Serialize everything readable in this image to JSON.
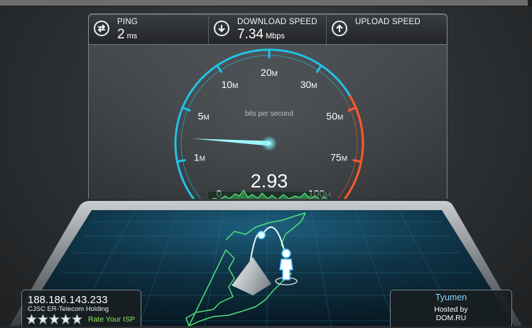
{
  "stats": {
    "ping": {
      "label": "PING",
      "value": "2",
      "unit": "ms",
      "icon": "ping-arrows-icon"
    },
    "download": {
      "label": "DOWNLOAD SPEED",
      "value": "7.34",
      "unit": "Mbps",
      "icon": "download-arrow-icon"
    },
    "upload": {
      "label": "UPLOAD SPEED",
      "value": "",
      "unit": "",
      "icon": "upload-arrow-icon"
    }
  },
  "gauge": {
    "caption": "bits per second",
    "current_value": "2.93",
    "ticks": [
      {
        "num": "0",
        "unit": ""
      },
      {
        "num": "1",
        "unit": "M"
      },
      {
        "num": "5",
        "unit": "M"
      },
      {
        "num": "10",
        "unit": "M"
      },
      {
        "num": "20",
        "unit": "M"
      },
      {
        "num": "30",
        "unit": "M"
      },
      {
        "num": "50",
        "unit": "M"
      },
      {
        "num": "75",
        "unit": "M"
      },
      {
        "num": "100",
        "unit": "M"
      }
    ],
    "needle_fraction": 0.18,
    "colors": {
      "scale": "#23c1e6",
      "high": "#ff5a2a",
      "needle": "#7ef4ff",
      "graph": "#3ddc6a"
    }
  },
  "client": {
    "ip": "188.186.143.233",
    "isp": "CJSC ER-Telecom Holding",
    "rating_stars": 5,
    "rate_label": "Rate Your ISP"
  },
  "server": {
    "city": "Tyumen",
    "hosted_by_label": "Hosted by",
    "host_name": "DOM.RU"
  }
}
